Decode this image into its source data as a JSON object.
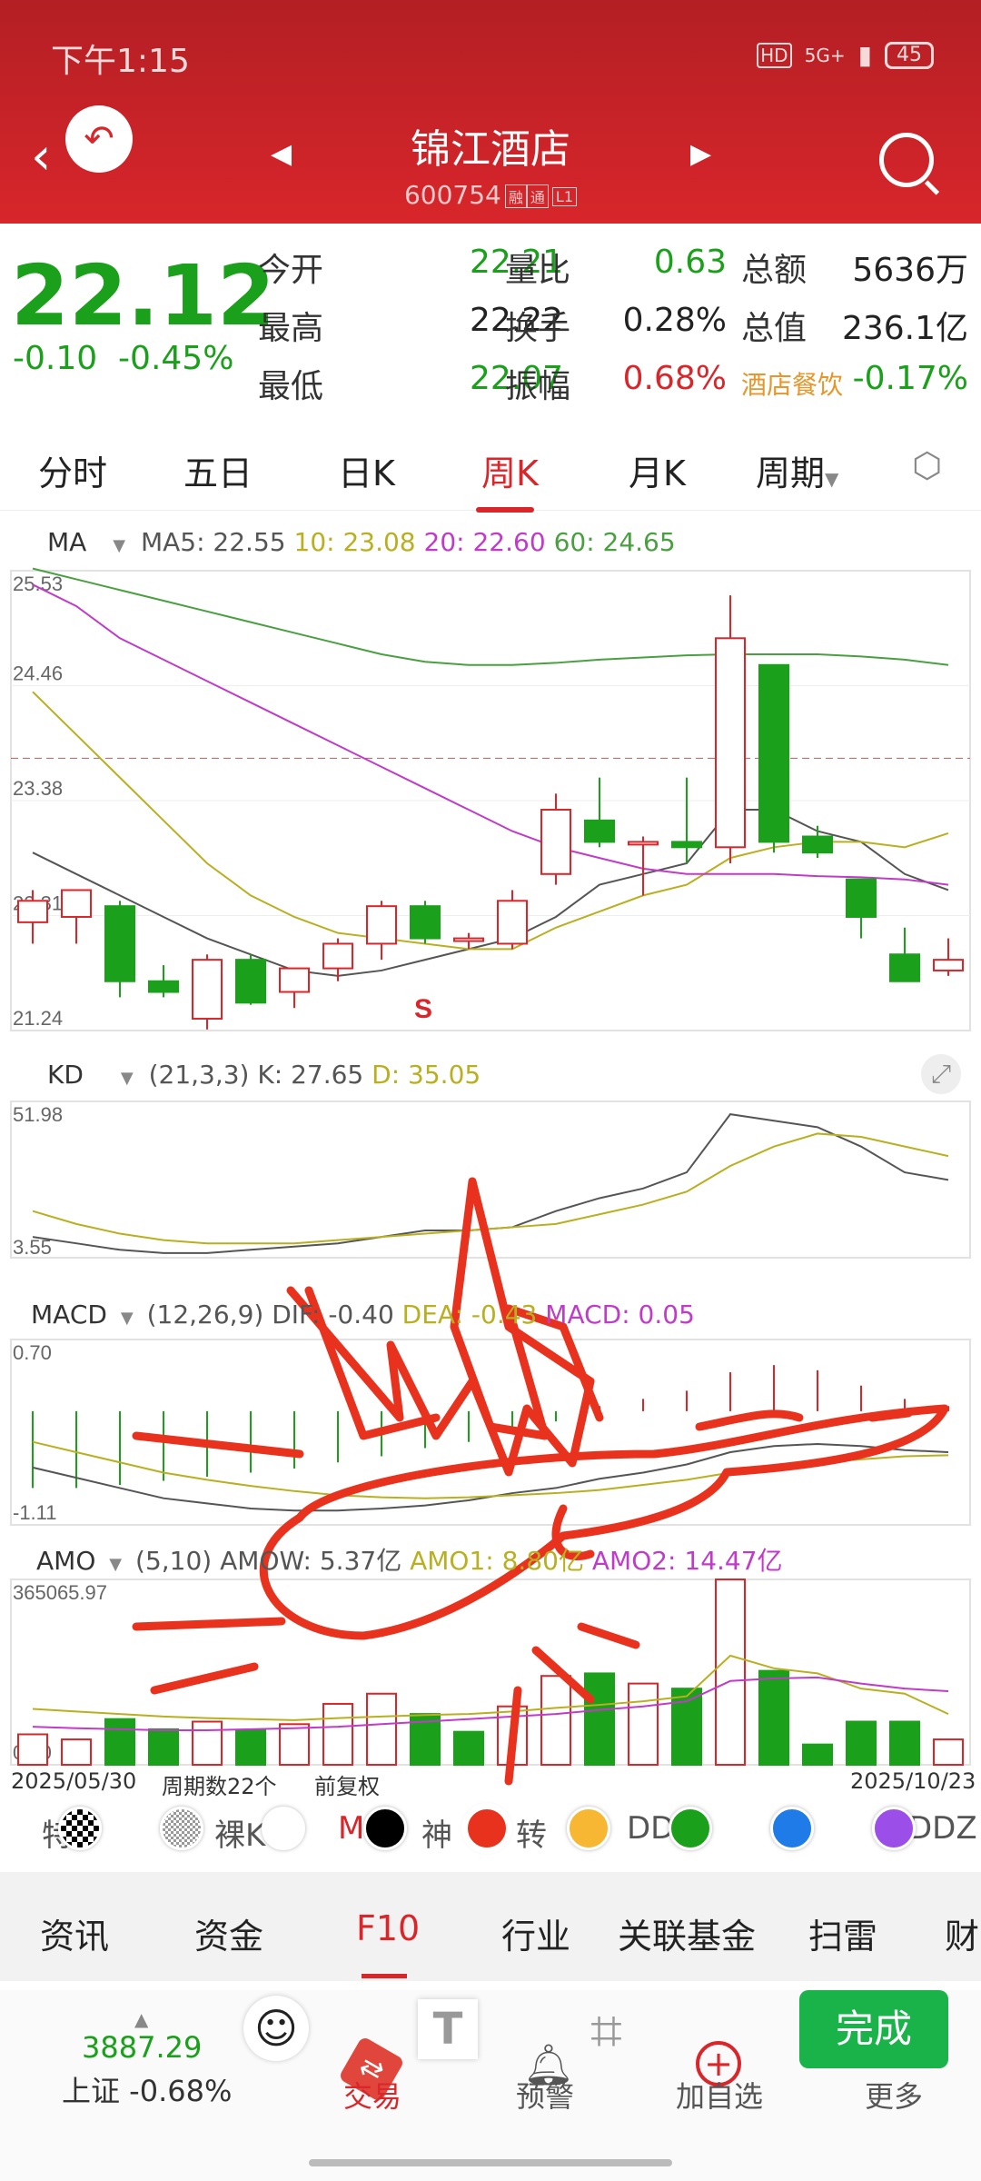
{
  "status": {
    "time": "下午1:15",
    "battery": "45",
    "hd": "HD",
    "net": "5G+"
  },
  "stock": {
    "name": "锦江酒店",
    "code": "600754",
    "tags": [
      "融",
      "通",
      "L1"
    ]
  },
  "quote": {
    "price": "22.12",
    "change": "-0.10",
    "change_pct": "-0.45%",
    "fields": [
      {
        "label": "今开",
        "value": "22.21",
        "color": "#1aa01a"
      },
      {
        "label": "量比",
        "value": "0.63",
        "color": "#1aa01a"
      },
      {
        "label": "总额",
        "value": "5636万",
        "color": "#222"
      },
      {
        "label": "最高",
        "value": "22.22",
        "color": "#222"
      },
      {
        "label": "换手",
        "value": "0.28%",
        "color": "#222"
      },
      {
        "label": "总值",
        "value": "236.1亿",
        "color": "#222"
      },
      {
        "label": "最低",
        "value": "22.07",
        "color": "#1aa01a"
      },
      {
        "label": "振幅",
        "value": "0.68%",
        "color": "#d8262b"
      },
      {
        "label": "酒店餐饮",
        "value": "-0.17%",
        "color": "#1aa01a",
        "label_color": "#e6962a"
      }
    ]
  },
  "tabs": [
    "分时",
    "五日",
    "日K",
    "周K",
    "月K",
    "周期"
  ],
  "ma": {
    "name": "MA",
    "ma5": "MA5: 22.55",
    "ma10": "10: 23.08",
    "ma20": "20: 22.60",
    "ma60": "60: 24.65",
    "y_ticks": [
      "25.53",
      "24.46",
      "23.38",
      "22.31",
      "21.24"
    ],
    "marker": "S"
  },
  "kd": {
    "name": "KD",
    "params": "(21,3,3)",
    "k": "K: 27.65",
    "d": "D: 35.05",
    "y_ticks": [
      "51.98",
      "3.55"
    ]
  },
  "macd": {
    "name": "MACD",
    "params": "(12,26,9)",
    "dif": "DIF: -0.40",
    "dea": "DEA: -0.43",
    "macd": "MACD: 0.05",
    "y_ticks": [
      "0.70",
      "-1.11"
    ]
  },
  "amo": {
    "name": "AMO",
    "params": "(5,10)",
    "amow": "AMOW: 5.37亿",
    "amo1": "AMO1: 8.80亿",
    "amo2": "AMO2: 14.47亿",
    "y_ticks": [
      "365065.97",
      "0.00"
    ]
  },
  "footer_info": {
    "start": "2025/05/30",
    "count": "周期数22个",
    "adj": "前复权",
    "end": "2025/10/23"
  },
  "indicator_tabs": [
    "特",
    "裸K",
    "M",
    "神",
    "转",
    "DD",
    "Y",
    "DDZ"
  ],
  "f10": [
    "资讯",
    "资金",
    "F10",
    "行业",
    "关联基金",
    "扫雷",
    "财"
  ],
  "dock": {
    "index_value": "3887.29",
    "index_label": "上证 -0.68%",
    "trade": "交易",
    "alert": "预警",
    "add": "加自选",
    "more": "更多",
    "done": "完成"
  },
  "colors": {
    "up": "#d8262b",
    "down": "#1aa01a",
    "ma5": "#555555",
    "ma10": "#b8b020",
    "ma20": "#c03cc8",
    "ma60": "#4aa040",
    "annotation": "#e8321e"
  },
  "chart_data": [
    {
      "type": "candlestick",
      "title": "周K",
      "ylim": [
        21.24,
        25.53
      ],
      "ohlc": [
        [
          22.25,
          22.55,
          22.05,
          22.45
        ],
        [
          22.3,
          22.55,
          22.05,
          22.55
        ],
        [
          22.4,
          22.45,
          21.55,
          21.7
        ],
        [
          21.7,
          21.85,
          21.55,
          21.6
        ],
        [
          21.35,
          21.95,
          21.25,
          21.9
        ],
        [
          21.9,
          21.95,
          21.48,
          21.5
        ],
        [
          21.6,
          21.8,
          21.45,
          21.82
        ],
        [
          21.82,
          22.1,
          21.7,
          22.05
        ],
        [
          22.05,
          22.45,
          21.9,
          22.4
        ],
        [
          22.4,
          22.45,
          22.05,
          22.1
        ],
        [
          22.1,
          22.15,
          22.0,
          22.1
        ],
        [
          22.05,
          22.55,
          22.0,
          22.45
        ],
        [
          22.7,
          23.45,
          22.6,
          23.3
        ],
        [
          23.2,
          23.6,
          22.95,
          23.0
        ],
        [
          23.0,
          23.05,
          22.5,
          23.0
        ],
        [
          23.0,
          23.6,
          22.8,
          22.95
        ],
        [
          22.95,
          25.3,
          22.8,
          24.9
        ],
        [
          24.65,
          24.65,
          22.9,
          23.0
        ],
        [
          23.05,
          23.15,
          22.85,
          22.9
        ],
        [
          22.65,
          22.65,
          22.1,
          22.3
        ],
        [
          21.95,
          22.2,
          21.7,
          21.7
        ],
        [
          21.8,
          22.1,
          21.75,
          21.9
        ]
      ],
      "series": [
        {
          "name": "MA5",
          "values": [
            22.9,
            22.7,
            22.5,
            22.3,
            22.1,
            21.95,
            21.8,
            21.75,
            21.8,
            21.9,
            22.0,
            22.1,
            22.3,
            22.6,
            22.7,
            22.8,
            23.3,
            23.3,
            23.1,
            23.0,
            22.7,
            22.55
          ]
        },
        {
          "name": "MA10",
          "values": [
            24.4,
            24.0,
            23.6,
            23.2,
            22.8,
            22.5,
            22.3,
            22.15,
            22.1,
            22.05,
            22.0,
            22.0,
            22.2,
            22.35,
            22.5,
            22.6,
            22.85,
            22.95,
            23.0,
            23.0,
            22.95,
            23.08
          ]
        },
        {
          "name": "MA20",
          "values": [
            25.4,
            25.2,
            24.9,
            24.7,
            24.5,
            24.3,
            24.1,
            23.9,
            23.7,
            23.5,
            23.3,
            23.1,
            22.95,
            22.85,
            22.75,
            22.7,
            22.7,
            22.7,
            22.68,
            22.67,
            22.65,
            22.6
          ]
        },
        {
          "name": "MA60",
          "values": [
            25.55,
            25.45,
            25.35,
            25.25,
            25.15,
            25.05,
            24.95,
            24.85,
            24.75,
            24.68,
            24.65,
            24.65,
            24.67,
            24.7,
            24.72,
            24.74,
            24.75,
            24.75,
            24.75,
            24.73,
            24.7,
            24.65
          ]
        }
      ]
    },
    {
      "type": "line",
      "title": "KD",
      "ylim": [
        3.55,
        51.98
      ],
      "series": [
        {
          "name": "K",
          "values": [
            10,
            8,
            6,
            5,
            5,
            6,
            7,
            8,
            10,
            12,
            12,
            13,
            18,
            22,
            25,
            30,
            48,
            46,
            44,
            38,
            30,
            27.65
          ]
        },
        {
          "name": "D",
          "values": [
            18,
            14,
            11,
            9,
            8,
            8,
            8,
            9,
            10,
            11,
            12,
            13,
            14,
            17,
            20,
            24,
            32,
            38,
            42,
            41,
            38,
            35.05
          ]
        }
      ]
    },
    {
      "type": "bar",
      "title": "MACD",
      "ylim": [
        -1.11,
        0.7
      ],
      "values": [
        -0.75,
        -0.75,
        -0.72,
        -0.68,
        -0.64,
        -0.6,
        -0.56,
        -0.5,
        -0.44,
        -0.36,
        -0.3,
        -0.2,
        -0.1,
        0.05,
        0.12,
        0.2,
        0.38,
        0.45,
        0.4,
        0.25,
        0.12,
        0.05
      ],
      "series": [
        {
          "name": "DIF",
          "values": [
            -0.55,
            -0.65,
            -0.75,
            -0.85,
            -0.9,
            -0.95,
            -0.97,
            -0.97,
            -0.95,
            -0.92,
            -0.87,
            -0.8,
            -0.75,
            -0.66,
            -0.6,
            -0.52,
            -0.4,
            -0.34,
            -0.32,
            -0.34,
            -0.38,
            -0.4
          ]
        },
        {
          "name": "DEA",
          "values": [
            -0.3,
            -0.4,
            -0.5,
            -0.6,
            -0.67,
            -0.73,
            -0.78,
            -0.82,
            -0.84,
            -0.85,
            -0.84,
            -0.82,
            -0.8,
            -0.77,
            -0.72,
            -0.67,
            -0.6,
            -0.55,
            -0.5,
            -0.47,
            -0.44,
            -0.43
          ]
        }
      ]
    },
    {
      "type": "bar",
      "title": "AMO",
      "ylim": [
        0,
        365065.97
      ],
      "values": [
        60000,
        50000,
        90000,
        70000,
        85000,
        68000,
        80000,
        120000,
        140000,
        100000,
        65000,
        115000,
        175000,
        180000,
        160000,
        150000,
        365000,
        185000,
        40000,
        85000,
        85000,
        50000
      ],
      "up": [
        true,
        true,
        false,
        false,
        true,
        false,
        true,
        true,
        true,
        false,
        false,
        true,
        true,
        false,
        true,
        false,
        true,
        false,
        false,
        false,
        false,
        true
      ],
      "series": [
        {
          "name": "AMO1",
          "values": [
            110000,
            105000,
            100000,
            95000,
            92000,
            90000,
            88000,
            92000,
            95000,
            98000,
            100000,
            105000,
            112000,
            118000,
            125000,
            135000,
            215000,
            190000,
            180000,
            150000,
            140000,
            100000
          ]
        },
        {
          "name": "AMO2",
          "values": [
            75000,
            72000,
            70000,
            68000,
            68000,
            70000,
            72000,
            75000,
            80000,
            85000,
            90000,
            95000,
            100000,
            108000,
            115000,
            125000,
            165000,
            170000,
            172000,
            160000,
            150000,
            145000
          ]
        }
      ]
    }
  ]
}
